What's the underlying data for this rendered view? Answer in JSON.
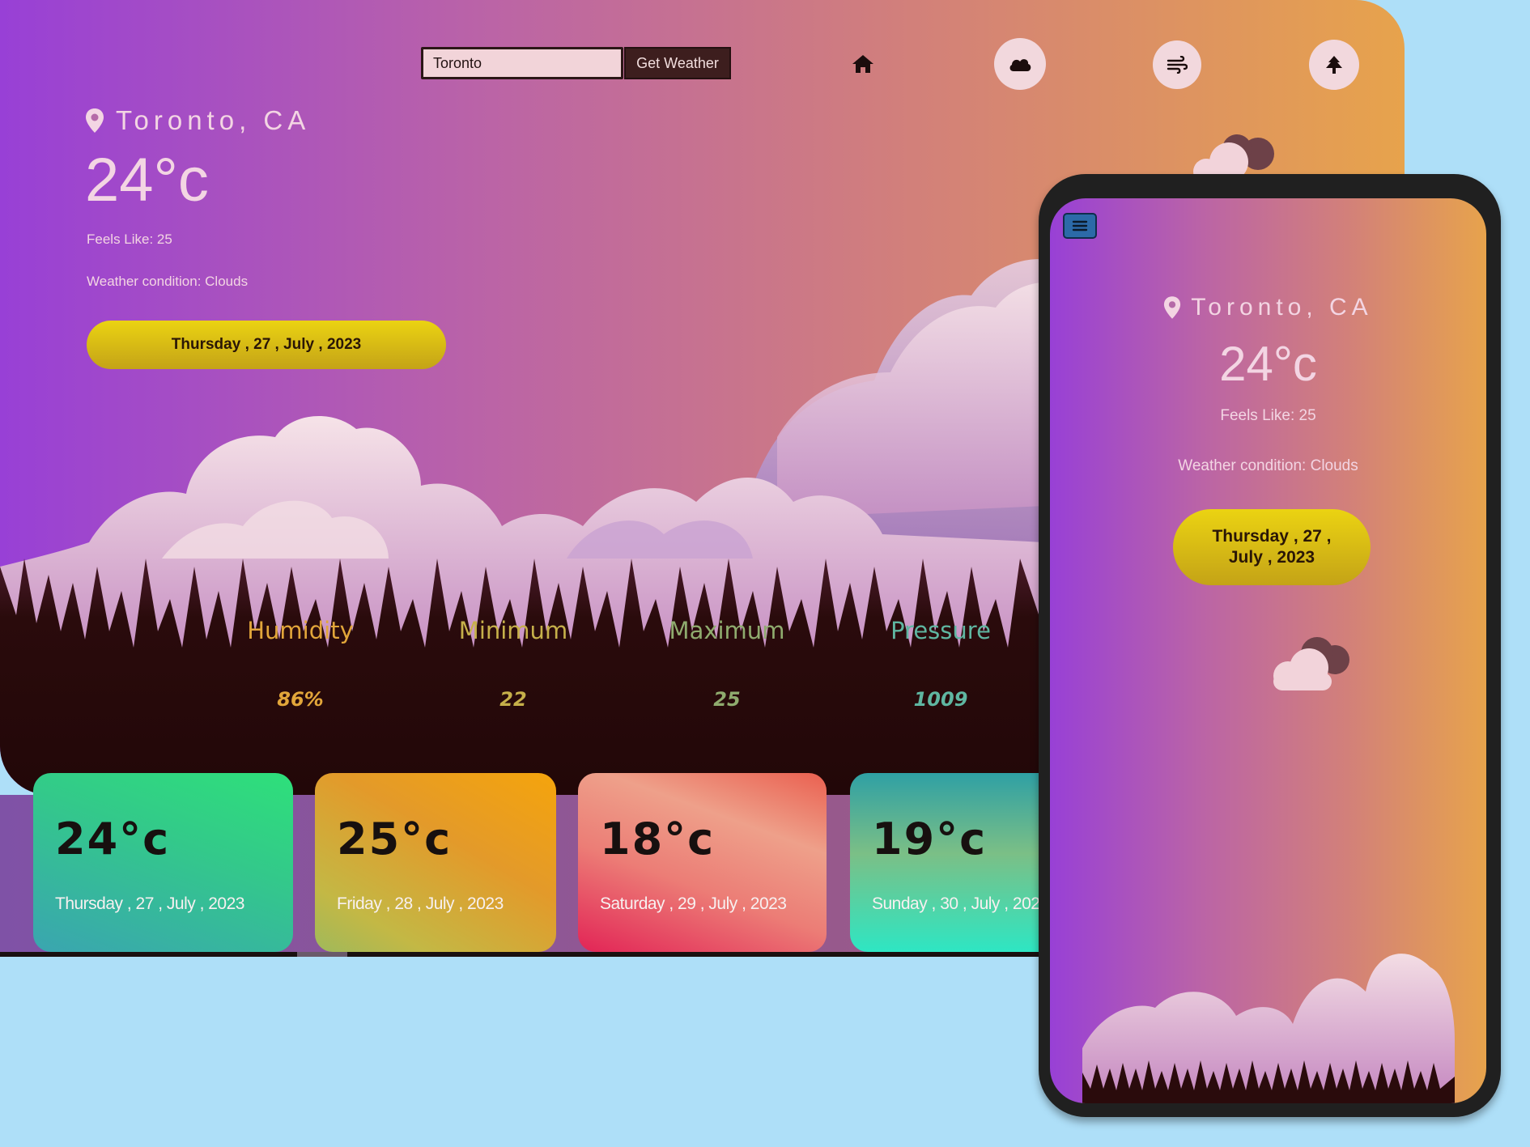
{
  "search": {
    "value": "Toronto",
    "button_label": "Get Weather"
  },
  "nav": {
    "icons": [
      "home-icon",
      "cloud-icon",
      "wind-icon",
      "tree-icon"
    ]
  },
  "current": {
    "location": "Toronto, CA",
    "temperature": "24°c",
    "feels_like": "Feels Like: 25",
    "condition": "Weather condition: Clouds",
    "date": "Thursday , 27 , July , 2023"
  },
  "stats": [
    {
      "label": "Humidity",
      "value": "86%",
      "color": "#e2a63a"
    },
    {
      "label": "Minimum",
      "value": "22",
      "color": "#c6b04a"
    },
    {
      "label": "Maximum",
      "value": "25",
      "color": "#8fab6e"
    },
    {
      "label": "Pressure",
      "value": "1009",
      "color": "#5fb6a1"
    }
  ],
  "forecast": [
    {
      "temp": "24°c",
      "date": "Thursday , 27 , July , 2023"
    },
    {
      "temp": "25°c",
      "date": "Friday , 28 , July , 2023"
    },
    {
      "temp": "18°c",
      "date": "Saturday , 29 , July , 2023"
    },
    {
      "temp": "19°c",
      "date": "Sunday , 30 , July , 2023"
    }
  ],
  "mobile": {
    "location": "Toronto, CA",
    "temperature": "24°c",
    "feels_like": "Feels Like: 25",
    "condition": "Weather condition: Clouds",
    "date": "Thursday , 27 , July , 2023"
  },
  "colors": {
    "gradient_start": "#9840d6",
    "gradient_end": "#e7a34c",
    "date_pill": "#ebd312",
    "ground": "#2a0b0c",
    "page_bg": "#aedff8"
  }
}
